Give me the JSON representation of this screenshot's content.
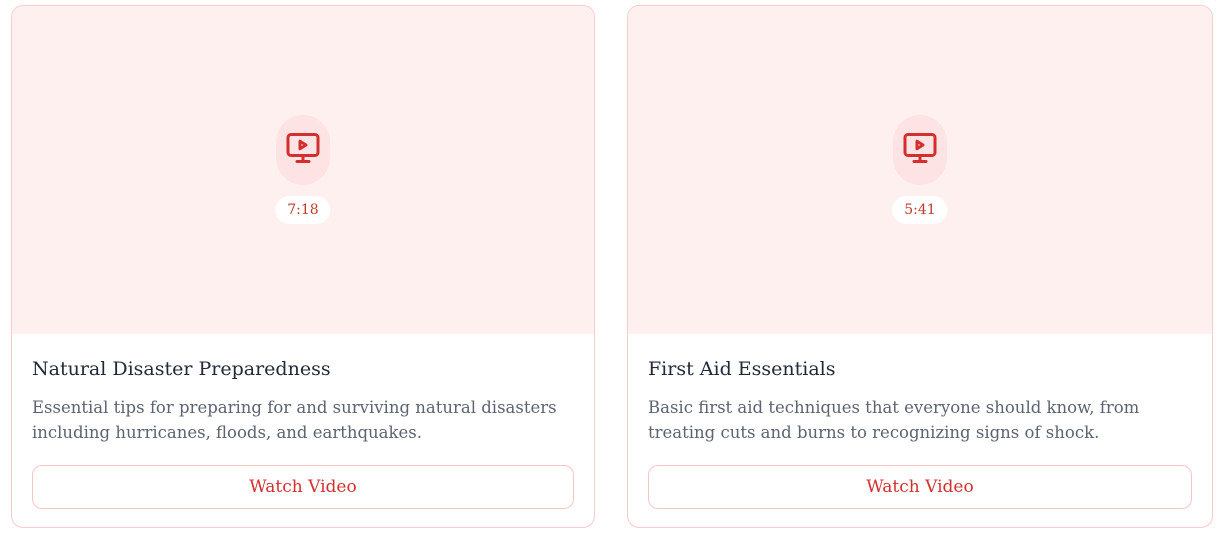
{
  "colors": {
    "accent": "#d32f2f",
    "thumbnail_bg": "#fff0f0",
    "icon_bg": "#fde3e3",
    "border": "#f8cccc"
  },
  "videos": [
    {
      "icon": "monitor-play-icon",
      "duration": "7:18",
      "title": "Natural Disaster Preparedness",
      "description": "Essential tips for preparing for and surviving natural disasters including hurricanes, floods, and earthquakes.",
      "button_label": "Watch Video"
    },
    {
      "icon": "monitor-play-icon",
      "duration": "5:41",
      "title": "First Aid Essentials",
      "description": "Basic first aid techniques that everyone should know, from treating cuts and burns to recognizing signs of shock.",
      "button_label": "Watch Video"
    }
  ]
}
